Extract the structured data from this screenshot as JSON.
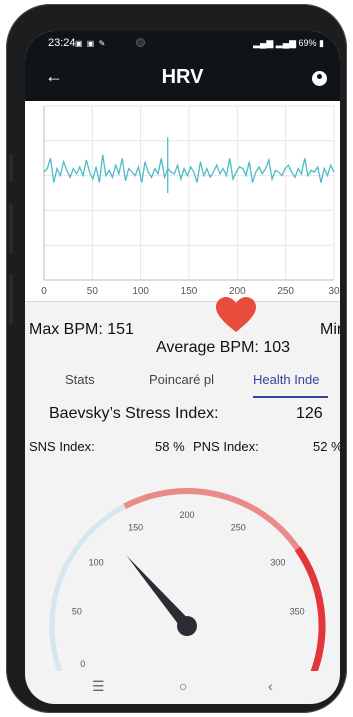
{
  "status_bar": {
    "time": "23:24",
    "battery": "69%"
  },
  "app_bar": {
    "title": "HRV",
    "back_icon": "arrow-left-icon",
    "account_icon": "account-circle-icon"
  },
  "chart_data": {
    "type": "line",
    "x_ticks": [
      "0",
      "50",
      "100",
      "150",
      "200",
      "250",
      "30"
    ],
    "ylim": [
      0,
      1000
    ],
    "xlim": [
      0,
      300
    ],
    "y_values": [
      620,
      640,
      700,
      560,
      640,
      600,
      680,
      630,
      590,
      640,
      610,
      650,
      600,
      690,
      620,
      580,
      650,
      560,
      720,
      600,
      630,
      590,
      660,
      610,
      700,
      570,
      640,
      620,
      600,
      650,
      560,
      680,
      620,
      590,
      640,
      610,
      700,
      590,
      640,
      620,
      610,
      660,
      580,
      640,
      600,
      650,
      620,
      560,
      680,
      600,
      640,
      590,
      620,
      660,
      610,
      640,
      600,
      700,
      580,
      620,
      650,
      640,
      600,
      680,
      560,
      620,
      650,
      610,
      640,
      690,
      580,
      630,
      620,
      600,
      640,
      660,
      620,
      590,
      640,
      610,
      700,
      600,
      630,
      620,
      650,
      560,
      640,
      600,
      660,
      620
    ],
    "spike_x": 128,
    "color": "#4cbcc8",
    "grid": true
  },
  "stats": {
    "max_bpm": "Max BPM: 151",
    "min_bpm": "Min",
    "avg_bpm": "Average BPM: 103"
  },
  "tabs": [
    {
      "label": "Stats"
    },
    {
      "label": "Poincaré pl"
    },
    {
      "label": "Health Inde"
    }
  ],
  "health": {
    "stress_label": "Baevsky’s Stress Index:",
    "stress_value": "126",
    "sns_label": "SNS Index:",
    "sns_value": "58 %",
    "pns_label": "PNS Index:",
    "pns_value": "52 %"
  },
  "gauge": {
    "value": 126,
    "min": 0,
    "max": 400,
    "labels": [
      "0",
      "50",
      "100",
      "150",
      "200",
      "250",
      "300",
      "350"
    ],
    "colors": {
      "low": "#d4e6ee",
      "mid": "#e98b89",
      "high": "#e2363b",
      "needle": "#2c2c34"
    }
  },
  "navbar": {
    "recents_icon": "recents-icon",
    "home_icon": "home-icon",
    "back_icon": "back-chevron-icon"
  },
  "colors": {
    "heart": "#e84c3d",
    "accent": "#3b3f9d",
    "header": "#101418"
  }
}
